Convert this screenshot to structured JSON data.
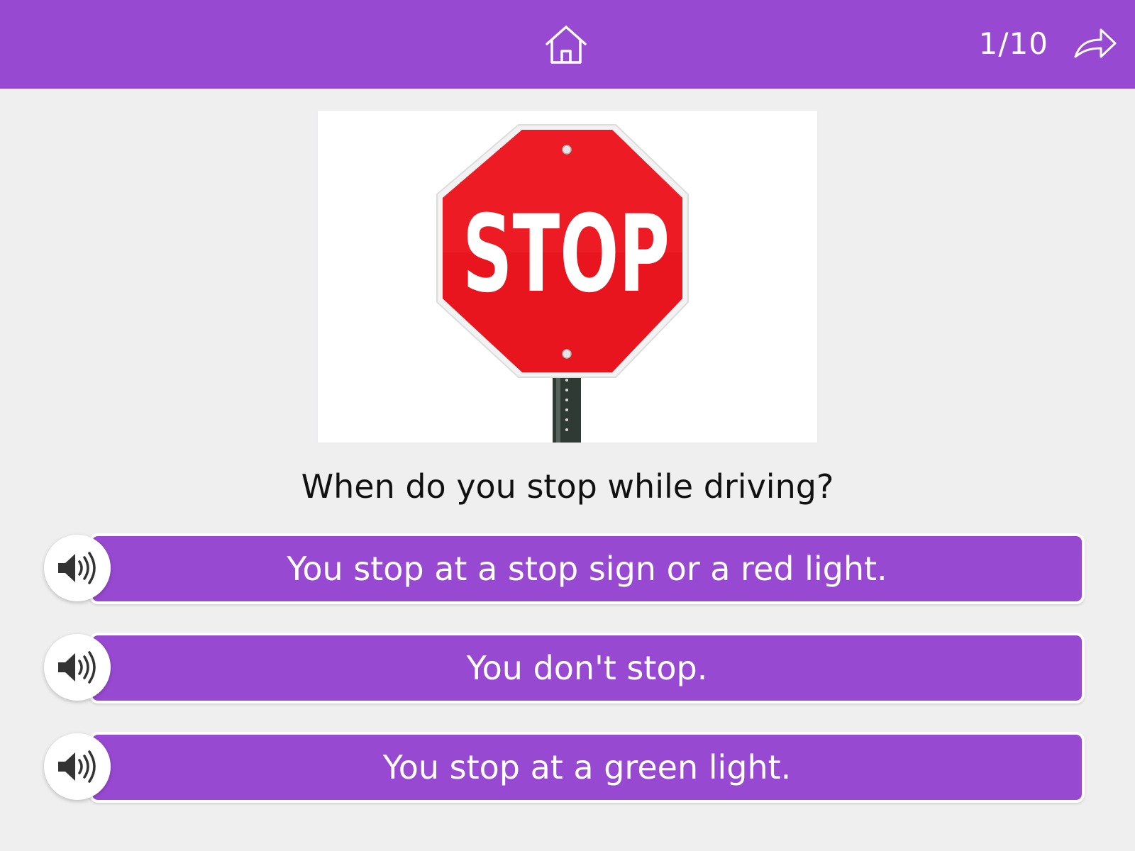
{
  "header": {
    "progress": "1/10",
    "home_icon": "home-icon",
    "next_icon": "forward-arrow-icon",
    "background_color": "#9849d1"
  },
  "image": {
    "sign_text": "STOP",
    "sign_color": "#e8141e"
  },
  "question": {
    "text": "When do you stop while driving?"
  },
  "answers": [
    {
      "label": "You stop at a stop sign or a red light.",
      "icon": "speaker-icon"
    },
    {
      "label": "You don't stop.",
      "icon": "speaker-icon"
    },
    {
      "label": "You stop at a green light.",
      "icon": "speaker-icon"
    }
  ],
  "colors": {
    "accent": "#9849d1",
    "background": "#efeff0",
    "button_text": "#ffffff",
    "question_text": "#111111"
  }
}
